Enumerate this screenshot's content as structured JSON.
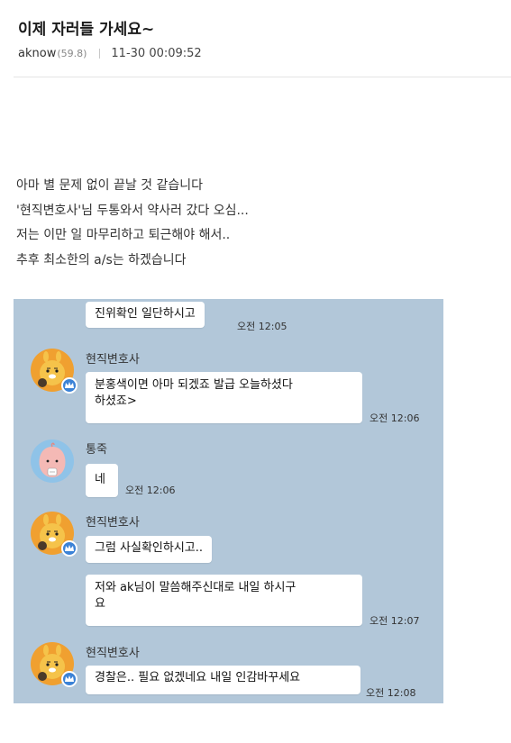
{
  "post": {
    "title": "이제 자러들 가세요~",
    "author": "aknow",
    "level": "(59.8)",
    "date": "11-30 00:09:52"
  },
  "body": {
    "lines": [
      "아마 별 문제 없이 끝날 것 같습니다",
      "'현직변호사'님 두통와서 약사러 갔다 오심...",
      "저는 이만 일 마무리하고 퇴근해야 해서..",
      "추후 최소한의 a/s는 하겠습니다"
    ]
  },
  "chat": {
    "background": "#b2c7d9",
    "avatars": {
      "lawyer": "ryan-lion-icon",
      "tongjuk": "apeach-icon"
    },
    "messages": [
      {
        "text": "진위확인 일단하시고",
        "time": "오전 12:05"
      },
      {
        "sender": "현직변호사",
        "text_lines": [
          "분홍색이면 아마 되겠죠 발급 오늘하셨다",
          "하셨죠>"
        ],
        "time": "오전 12:06"
      },
      {
        "sender": "통죽",
        "text": "네",
        "time": "오전 12:06"
      },
      {
        "sender": "현직변호사",
        "text": "그럼 사실확인하시고..",
        "time": ""
      },
      {
        "text_lines": [
          "저와 ak님이 말씀해주신대로 내일 하시구",
          "요"
        ],
        "time": "오전 12:07"
      },
      {
        "sender": "현직변호사",
        "text": "경찰은.. 필요 없겠네요 내일 인감바꾸세요",
        "time": "오전 12:08"
      }
    ]
  }
}
